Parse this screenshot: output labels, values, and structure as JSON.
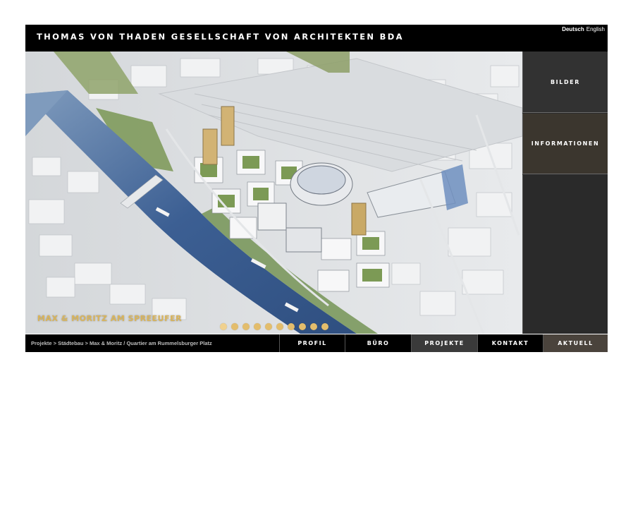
{
  "header": {
    "title": "THOMAS VON THADEN GESELLSCHAFT VON ARCHITEKTEN BDA",
    "lang_de": "Deutsch",
    "lang_en": "English"
  },
  "hero": {
    "project_title": "MAX & MORITZ AM SPREEUFER",
    "slide_count": 10,
    "active_slide": 1
  },
  "side_panel": {
    "bilder": "BILDER",
    "informationen": "INFORMATIONEN"
  },
  "footer": {
    "breadcrumb": "Projekte > Städtebau > Max & Moritz / Quartier am Rummelsburger Platz",
    "nav": {
      "profil": "PROFIL",
      "buero": "BÜRO",
      "projekte": "PROJEKTE",
      "kontakt": "KONTAKT",
      "aktuell": "AKTUELL"
    }
  },
  "colors": {
    "accent_gold": "#e3bd6c",
    "header_bg": "#000000",
    "panel_bg": "#2b2b2b"
  }
}
